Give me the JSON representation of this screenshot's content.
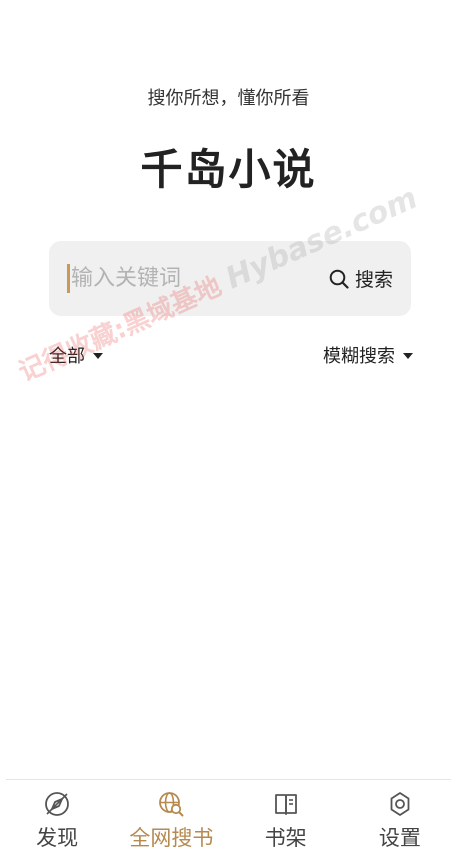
{
  "header": {
    "tagline": "搜你所想，懂你所看",
    "title": "千岛小说"
  },
  "search": {
    "placeholder": "输入关键词",
    "value": "",
    "button_label": "搜索"
  },
  "filters": {
    "scope_label": "全部",
    "mode_label": "模糊搜索"
  },
  "watermark": {
    "text_cn": "记得收藏:黑域基地",
    "text_latin": "Hybase.com"
  },
  "tabbar": {
    "tabs": [
      {
        "label": "发现",
        "icon": "compass-icon",
        "active": false
      },
      {
        "label": "全网搜书",
        "icon": "globe-search-icon",
        "active": true
      },
      {
        "label": "书架",
        "icon": "book-icon",
        "active": false
      },
      {
        "label": "设置",
        "icon": "gear-icon",
        "active": false
      }
    ]
  },
  "colors": {
    "accent": "#b68a4f",
    "inactive": "#444444",
    "search_bg": "#f0f0f0"
  }
}
